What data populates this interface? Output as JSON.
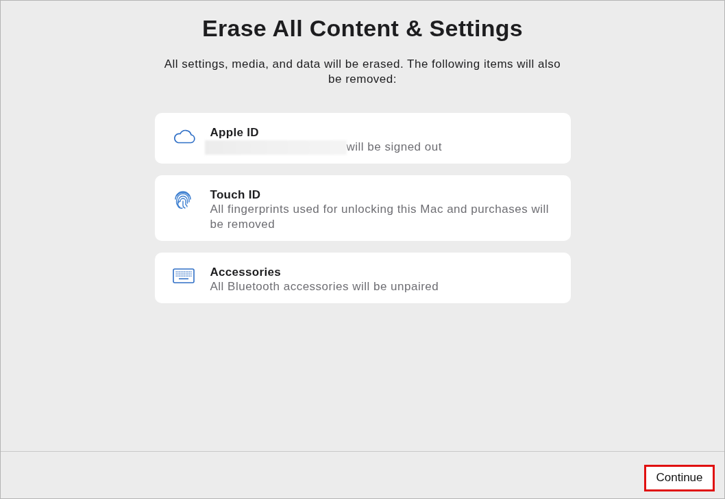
{
  "title": "Erase All Content & Settings",
  "intro": "All settings, media, and data will be erased. The following items will also be removed:",
  "items": [
    {
      "kind": "account",
      "title": "Apple ID",
      "redacted": true,
      "description": "will be signed out"
    },
    {
      "kind": "biometric",
      "title": "Touch ID",
      "description": "All fingerprints used for unlocking this Mac and purchases will be removed"
    },
    {
      "kind": "accessory",
      "title": "Accessories",
      "description": "All Bluetooth accessories will be unpaired"
    }
  ],
  "footer": {
    "button": {
      "label": "Continue",
      "highlighted": true
    }
  }
}
